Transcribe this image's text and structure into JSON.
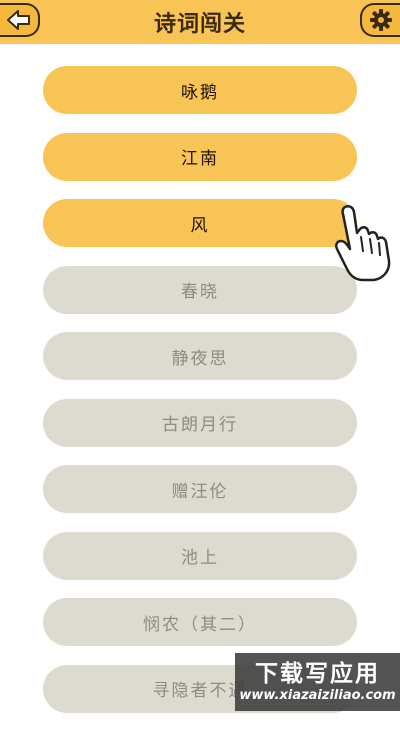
{
  "header": {
    "title": "诗词闯关",
    "back_icon": "back-arrow-icon",
    "settings_icon": "gear-icon"
  },
  "levels": [
    {
      "label": "咏鹅",
      "status": "unlocked"
    },
    {
      "label": "江南",
      "status": "unlocked"
    },
    {
      "label": "风",
      "status": "unlocked"
    },
    {
      "label": "春晓",
      "status": "locked"
    },
    {
      "label": "静夜思",
      "status": "locked"
    },
    {
      "label": "古朗月行",
      "status": "locked"
    },
    {
      "label": "赠汪伦",
      "status": "locked"
    },
    {
      "label": "池上",
      "status": "locked"
    },
    {
      "label": "悯农（其二）",
      "status": "locked"
    },
    {
      "label": "寻隐者不遇",
      "status": "locked"
    }
  ],
  "hint": {
    "icon": "pointing-hand-icon"
  },
  "watermark": {
    "title": "下载写应用",
    "url": "www.xiazaiziliao.com"
  },
  "colors": {
    "accent": "#f8c455",
    "locked": "#dddbcf",
    "locked_text": "#8d8b83",
    "dark": "#3a2a10"
  }
}
